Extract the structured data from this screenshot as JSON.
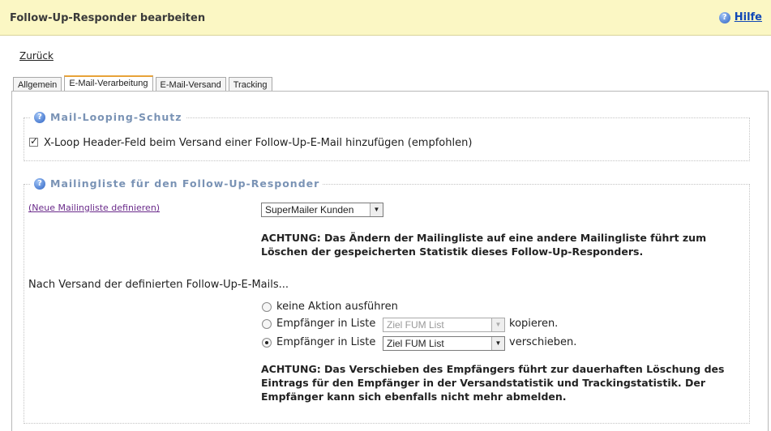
{
  "header": {
    "title": "Follow-Up-Responder bearbeiten",
    "help_label": "Hilfe"
  },
  "back_link": "Zurück",
  "tabs": [
    {
      "label": "Allgemein",
      "active": false
    },
    {
      "label": "E-Mail-Verarbeitung",
      "active": true
    },
    {
      "label": "E-Mail-Versand",
      "active": false
    },
    {
      "label": "Tracking",
      "active": false
    }
  ],
  "looping": {
    "legend": "Mail-Looping-Schutz",
    "checkbox_label": "X-Loop Header-Feld beim Versand einer Follow-Up-E-Mail hinzufügen (empfohlen)",
    "checked": true
  },
  "mailinglist": {
    "legend": "Mailingliste für den Follow-Up-Responder",
    "define_link": "(Neue Mailingliste definieren)",
    "selected_list": "SuperMailer Kunden",
    "warning": [
      "ACHTUNG: Das Ändern der Mailingliste auf eine andere Mailingliste führt zum",
      "Löschen der gespeicherten Statistik dieses Follow-Up-Responders."
    ],
    "after_send_label": "Nach Versand der definierten Follow-Up-E-Mails...",
    "options": [
      {
        "label": "keine Aktion ausführen",
        "checked": false
      },
      {
        "label": "Empfänger in Liste",
        "select_value": "Ziel FUM List",
        "suffix": "kopieren.",
        "checked": false,
        "disabled": true
      },
      {
        "label": "Empfänger in Liste",
        "select_value": "Ziel FUM List",
        "suffix": "verschieben.",
        "checked": true,
        "disabled": false
      }
    ],
    "warning2": [
      "ACHTUNG: Das Verschieben des Empfängers führt zur dauerhaften Löschung des",
      "Eintrags für den Empfänger in der Versandstatistik und Trackingstatistik. Der",
      "Empfänger kann sich ebenfalls nicht mehr abmelden."
    ]
  },
  "icons": {
    "help": "help-question-icon",
    "checkbox": "checkbox-checked-icon"
  },
  "colors": {
    "header_bg": "#fbf7c4",
    "legend_text": "#7a93b5",
    "active_tab_border": "#e8a238",
    "link_blue": "#1048b6"
  }
}
